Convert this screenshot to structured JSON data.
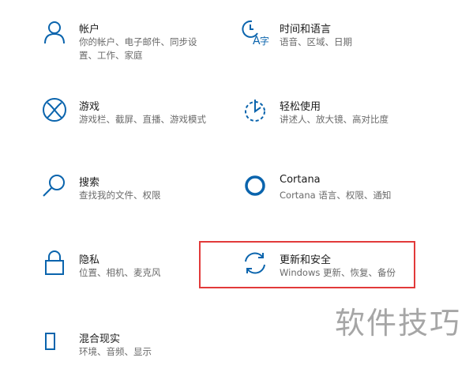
{
  "colors": {
    "accent": "#0a64ad",
    "highlight_border": "#e23a3a",
    "title": "#1b1b1b",
    "desc": "#6a6a6a"
  },
  "items": [
    {
      "icon": "account-icon",
      "title": "帐户",
      "desc_lines": [
        "你的帐户、电子邮件、同步设",
        "置、工作、家庭"
      ]
    },
    {
      "icon": "time-language-icon",
      "title": "时间和语言",
      "desc_lines": [
        "语音、区域、日期"
      ]
    },
    {
      "icon": "xbox-gaming-icon",
      "title": "游戏",
      "desc_lines": [
        "游戏栏、截屏、直播、游戏模式"
      ]
    },
    {
      "icon": "ease-of-access-icon",
      "title": "轻松使用",
      "desc_lines": [
        "讲述人、放大镜、高对比度"
      ]
    },
    {
      "icon": "search-icon",
      "title": "搜索",
      "desc_lines": [
        "查找我的文件、权限"
      ]
    },
    {
      "icon": "cortana-icon",
      "title": "Cortana",
      "desc_lines": [
        "Cortana 语言、权限、通知"
      ]
    },
    {
      "icon": "privacy-lock-icon",
      "title": "隐私",
      "desc_lines": [
        "位置、相机、麦克风"
      ]
    },
    {
      "icon": "update-sync-icon",
      "title": "更新和安全",
      "desc_lines": [
        "Windows 更新、恢复、备份"
      ]
    },
    {
      "icon": "mixed-reality-icon",
      "title": "混合现实",
      "desc_lines": [
        "环境、音频、显示"
      ]
    }
  ],
  "watermark": "软件技巧"
}
